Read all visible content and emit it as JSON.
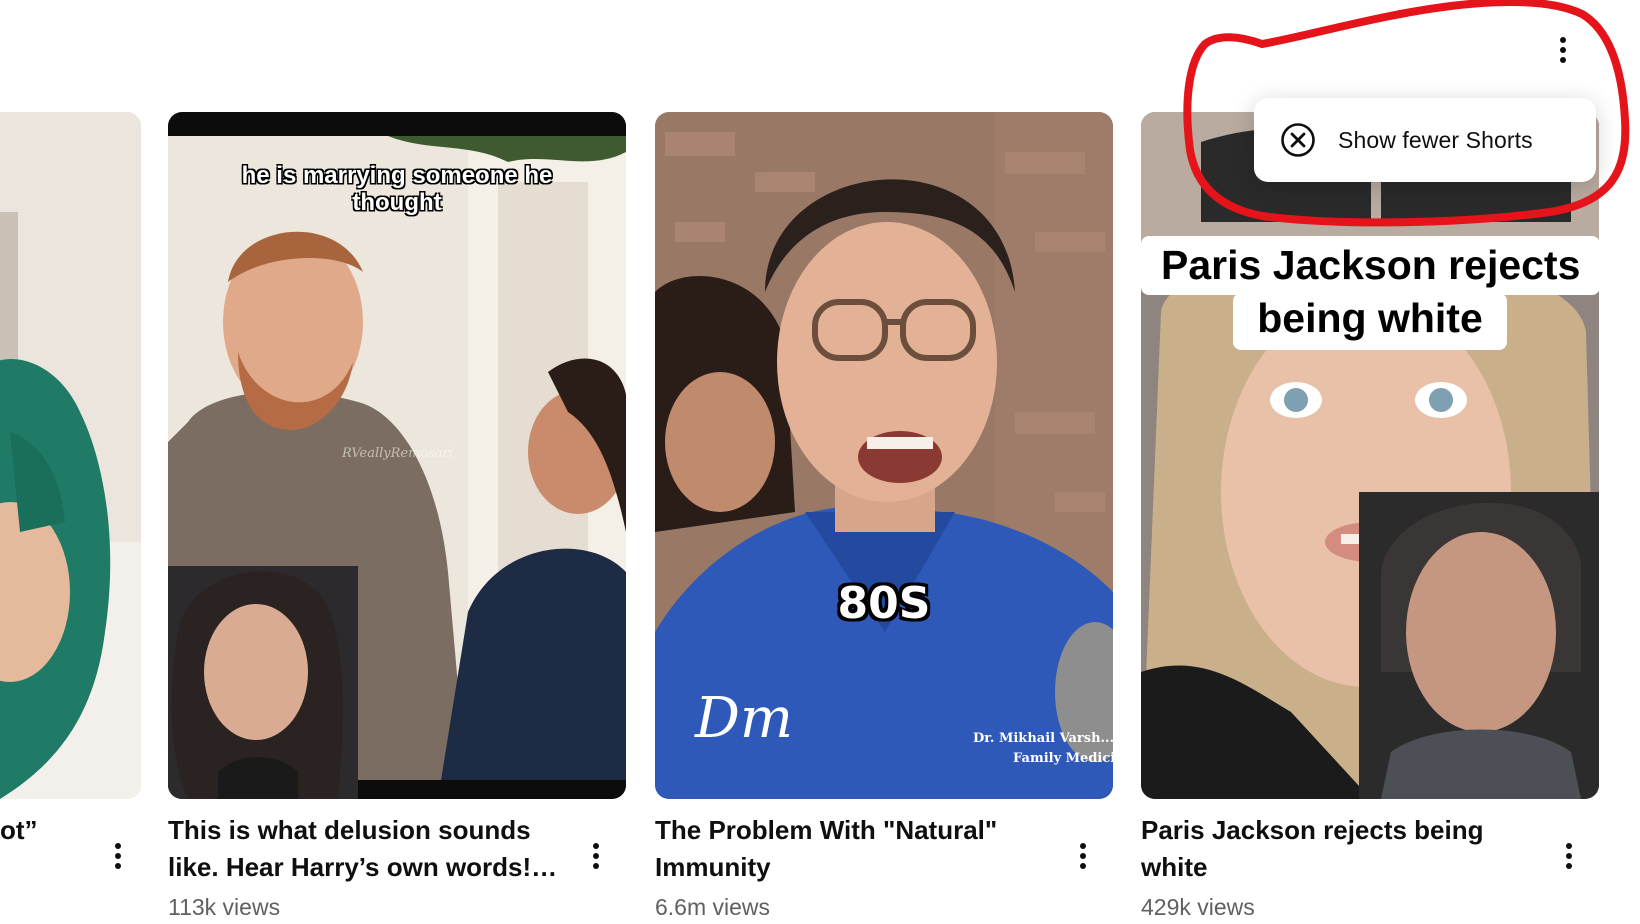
{
  "shelf": {
    "menu_icon": "more-vert-icon",
    "popup_menu": {
      "items": [
        {
          "icon": "circle-x-icon",
          "label": "Show fewer Shorts"
        }
      ]
    },
    "annotation_color": "#e5141b"
  },
  "shorts": [
    {
      "title": "ot”",
      "views": "",
      "partial": true
    },
    {
      "title": "This is what delusion sounds like. Hear Harry’s own words! …",
      "views": "113k views",
      "overlay_caption": "he is marrying someone he thought",
      "watermark": "RVeallyRemosari"
    },
    {
      "title": "The Problem With \"Natural\" Immunity",
      "views": "6.6m views",
      "overlay_caption": "80S",
      "lower_third_line1": "Dr. Mikhail Varsh...",
      "lower_third_line2": "Family Medicine",
      "logo": "Dm"
    },
    {
      "title": "Paris Jackson rejects being white",
      "views": "429k views",
      "overlay_caption_line1": "Paris Jackson rejects",
      "overlay_caption_line2": "being white"
    }
  ]
}
